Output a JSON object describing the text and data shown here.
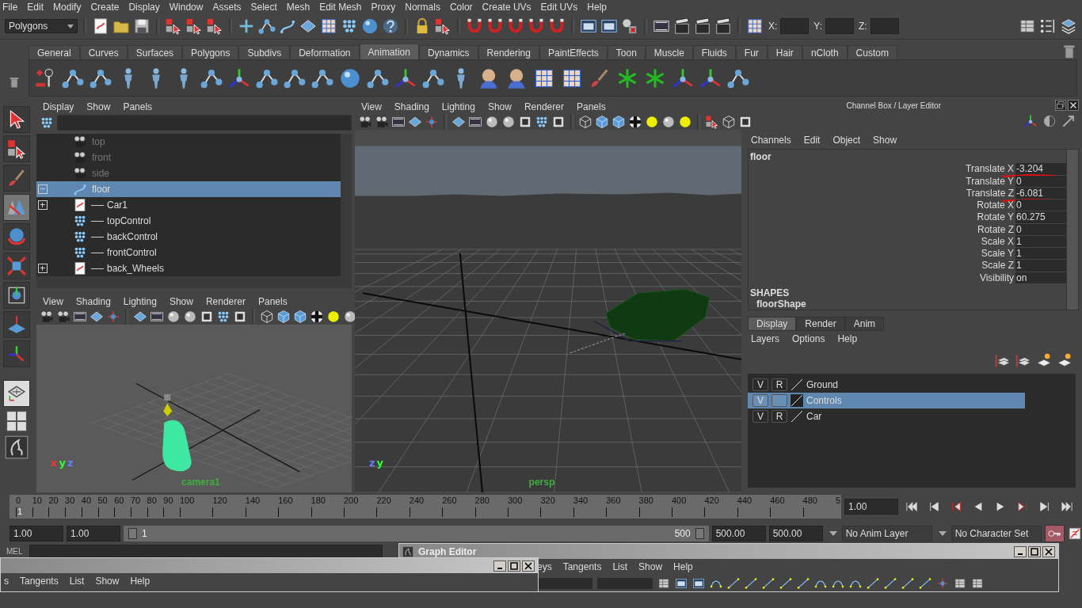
{
  "menu_bar": [
    "File",
    "Edit",
    "Modify",
    "Create",
    "Display",
    "Window",
    "Assets",
    "Select",
    "Mesh",
    "Edit Mesh",
    "Proxy",
    "Normals",
    "Color",
    "Create UVs",
    "Edit UVs",
    "Help"
  ],
  "status_line": {
    "menu_set": "Polygons",
    "coord_labels": [
      "X:",
      "Y:",
      "Z:"
    ]
  },
  "shelf": {
    "tabs": [
      {
        "label": "General",
        "selected": false
      },
      {
        "label": "Curves",
        "selected": false
      },
      {
        "label": "Surfaces",
        "selected": false
      },
      {
        "label": "Polygons",
        "selected": false
      },
      {
        "label": "Subdivs",
        "selected": false
      },
      {
        "label": "Deformation",
        "selected": false
      },
      {
        "label": "Animation",
        "selected": true
      },
      {
        "label": "Dynamics",
        "selected": false
      },
      {
        "label": "Rendering",
        "selected": false
      },
      {
        "label": "PaintEffects",
        "selected": false
      },
      {
        "label": "Toon",
        "selected": false
      },
      {
        "label": "Muscle",
        "selected": false
      },
      {
        "label": "Fluids",
        "selected": false
      },
      {
        "label": "Fur",
        "selected": false
      },
      {
        "label": "Hair",
        "selected": false
      },
      {
        "label": "nCloth",
        "selected": false
      },
      {
        "label": "Custom",
        "selected": false
      }
    ]
  },
  "tool_box": [
    {
      "selected": false
    },
    {
      "selected": false
    },
    {
      "selected": false
    },
    {
      "selected": true
    },
    {
      "selected": false
    },
    {
      "selected": false
    },
    {
      "selected": false
    },
    {
      "selected": false
    },
    {
      "selected": false
    }
  ],
  "outliner": {
    "menus": [
      "Display",
      "Show",
      "Panels"
    ],
    "items": [
      {
        "name": "top",
        "kind": "camera",
        "dimmed": true,
        "selected": false
      },
      {
        "name": "front",
        "kind": "camera",
        "dimmed": true,
        "selected": false
      },
      {
        "name": "side",
        "kind": "camera",
        "dimmed": true,
        "selected": false
      },
      {
        "name": "floor",
        "kind": "curve",
        "dimmed": false,
        "selected": true,
        "expanded": true,
        "children": [
          {
            "name": "Car1",
            "kind": "transform",
            "dimmed": false,
            "selected": false,
            "expanded": false
          },
          {
            "name": "topControl",
            "kind": "locator",
            "dimmed": false,
            "selected": false
          },
          {
            "name": "backControl",
            "kind": "locator",
            "dimmed": false,
            "selected": false
          },
          {
            "name": "frontControl",
            "kind": "locator",
            "dimmed": false,
            "selected": false
          },
          {
            "name": "back_Wheels",
            "kind": "transform",
            "dimmed": false,
            "selected": false,
            "expanded": false
          }
        ]
      }
    ]
  },
  "camera_view": {
    "menus": [
      "View",
      "Shading",
      "Lighting",
      "Show",
      "Renderer",
      "Panels"
    ],
    "axis_labels": [
      "x",
      "y",
      "z"
    ],
    "camera": "camera1"
  },
  "perspective_view": {
    "menus": [
      "View",
      "Shading",
      "Lighting",
      "Show",
      "Renderer",
      "Panels"
    ],
    "axis_labels": [
      "z",
      "y"
    ],
    "camera": "persp"
  },
  "channel_box": {
    "title": "Channel Box / Layer Editor",
    "menus": [
      "Channels",
      "Edit",
      "Object",
      "Show"
    ],
    "object": "floor",
    "channels": [
      {
        "name": "Translate X",
        "value": "-3.204",
        "marked": true
      },
      {
        "name": "Translate Y",
        "value": "0",
        "marked": false
      },
      {
        "name": "Translate Z",
        "value": "-6.081",
        "marked": true
      },
      {
        "name": "Rotate X",
        "value": "0",
        "marked": false
      },
      {
        "name": "Rotate Y",
        "value": "60.275",
        "marked": false
      },
      {
        "name": "Rotate Z",
        "value": "0",
        "marked": false
      },
      {
        "name": "Scale X",
        "value": "1",
        "marked": false
      },
      {
        "name": "Scale Y",
        "value": "1",
        "marked": false
      },
      {
        "name": "Scale Z",
        "value": "1",
        "marked": false
      },
      {
        "name": "Visibility",
        "value": "on",
        "marked": false
      }
    ],
    "shapes_heading": "SHAPES",
    "shape": "floorShape"
  },
  "layer_editor": {
    "tabs": [
      {
        "label": "Display",
        "selected": true
      },
      {
        "label": "Render",
        "selected": false
      },
      {
        "label": "Anim",
        "selected": false
      }
    ],
    "menus": [
      "Layers",
      "Options",
      "Help"
    ],
    "layers": [
      {
        "name": "Ground",
        "visibility": "V",
        "mode": "R",
        "selected": false
      },
      {
        "name": "Controls",
        "visibility": "V",
        "selected": true
      },
      {
        "name": "Car",
        "visibility": "V",
        "mode": "R",
        "selected": false
      }
    ]
  },
  "time_slider": {
    "ticks": [
      "0",
      "10",
      "20",
      "30",
      "40",
      "50",
      "60",
      "70",
      "80",
      "90",
      "100",
      "120",
      "140",
      "160",
      "180",
      "200",
      "220",
      "240",
      "260",
      "280",
      "300",
      "320",
      "340",
      "360",
      "380",
      "400",
      "420",
      "440",
      "460",
      "480",
      "5"
    ],
    "current_frame": "1",
    "current_time": "1.00"
  },
  "range_slider": {
    "level": 1,
    "start_time": "1.00",
    "playback_start": "1.00",
    "range_start": "1",
    "range_end": "500",
    "playback_end": "500.00",
    "end_time": "500.00",
    "anim_layer": "No Anim Layer",
    "character_set": "No Character Set"
  },
  "command_line": {
    "label": "MEL"
  },
  "graph_editor": {
    "title": "Graph Editor",
    "menus": [
      "eys",
      "Tangents",
      "List",
      "Show",
      "Help"
    ]
  },
  "front_window": {
    "menus": [
      "s",
      "Tangents",
      "List",
      "Show",
      "Help"
    ]
  }
}
